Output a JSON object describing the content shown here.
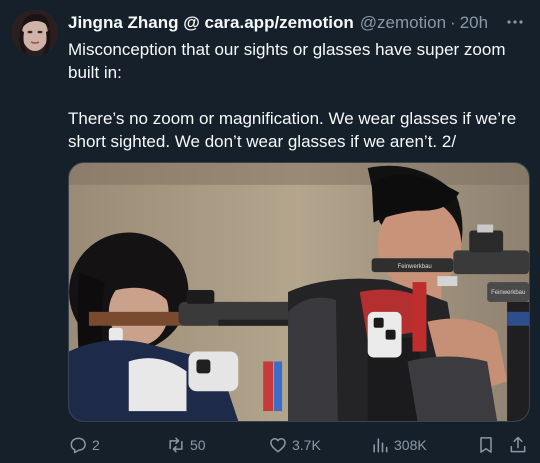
{
  "author": {
    "display_name": "Jingna Zhang @ cara.app/zemotion",
    "handle": "@zemotion",
    "separator": "·",
    "time": "20h",
    "avatar_icon": "profile-photo"
  },
  "tweet": {
    "paragraphs": [
      "Misconception that our sights or glasses have super zoom built in:",
      "There’s no zoom or magnification. We wear glasses if we’re short sighted. We don’t wear glasses if we aren’t. 2/"
    ]
  },
  "media": {
    "rifle_brand_1": "Feinwerkbau",
    "rifle_brand_2": "Feinwerkbau"
  },
  "actions": {
    "replies": "2",
    "reposts": "50",
    "likes": "3.7K",
    "views": "308K"
  },
  "colors": {
    "background": "#15202b",
    "text_primary": "#f7f9f9",
    "text_secondary": "#8b98a5",
    "border": "#38444d"
  }
}
